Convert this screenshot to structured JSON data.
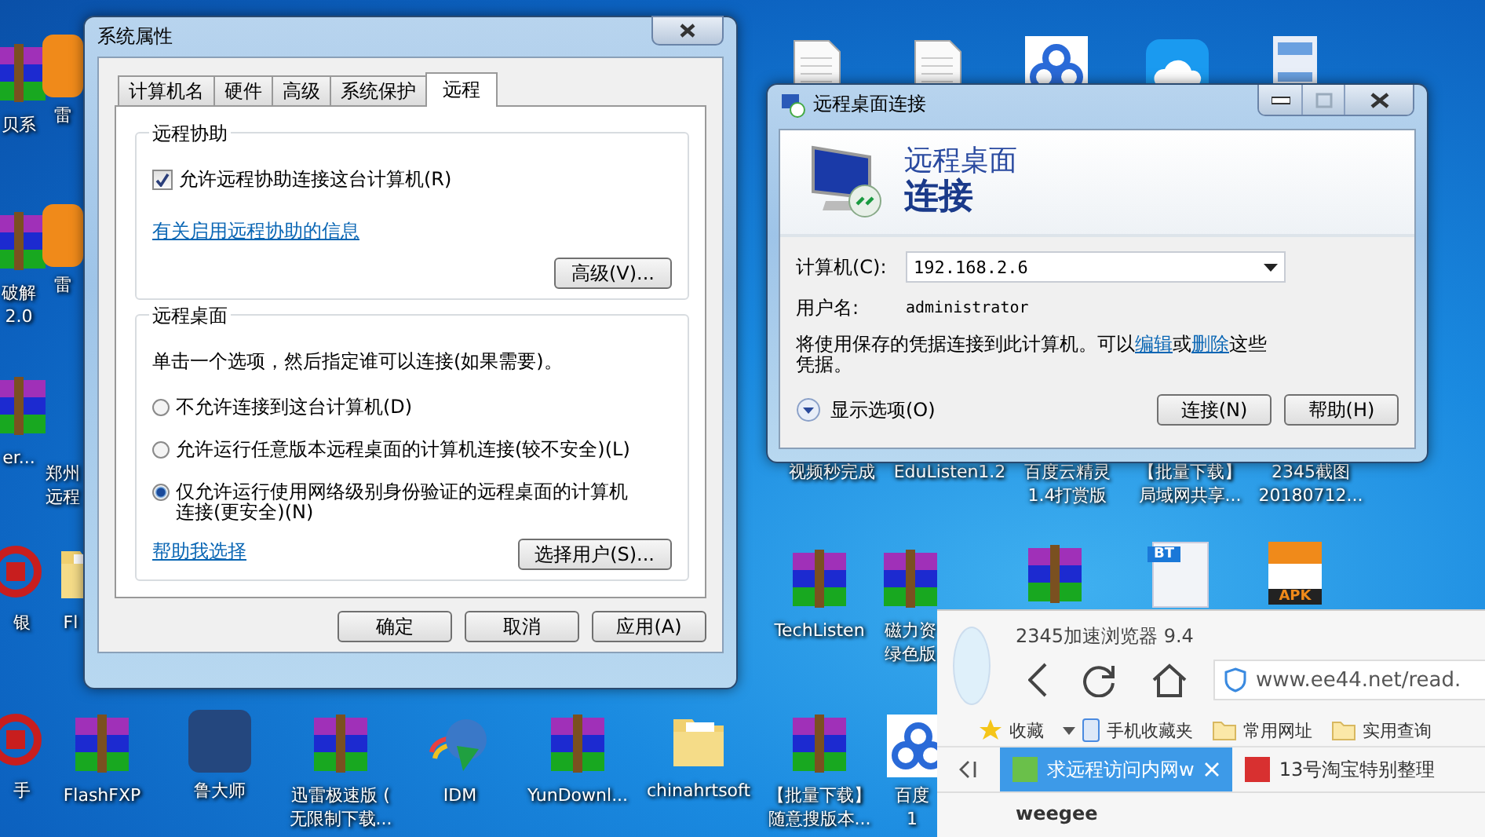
{
  "desktop_icons": [
    {
      "kind": "archive",
      "lines": [
        "贝系"
      ]
    },
    {
      "kind": "orange",
      "lines": [
        "雷"
      ]
    },
    {
      "kind": "archive",
      "lines": [
        "破解",
        "2.0"
      ]
    },
    {
      "kind": "orange",
      "lines": [
        "雷"
      ]
    },
    {
      "kind": "archive",
      "lines": [
        "er..."
      ]
    },
    {
      "kind": "hidden",
      "lines": [
        "郑州",
        "远程"
      ]
    },
    {
      "kind": "redring",
      "lines": [
        "银"
      ]
    },
    {
      "kind": "folder",
      "lines": [
        "Fl"
      ]
    },
    {
      "kind": "redring",
      "lines": [
        "手"
      ]
    },
    {
      "kind": "archive",
      "lines": [
        "FlashFXP"
      ]
    },
    {
      "kind": "app",
      "lines": [
        "鲁大师"
      ]
    },
    {
      "kind": "archive",
      "lines": [
        "迅雷极速版 (",
        "无限制下载..."
      ]
    },
    {
      "kind": "globe",
      "lines": [
        "IDM"
      ]
    },
    {
      "kind": "archive",
      "lines": [
        "YunDownl..."
      ]
    },
    {
      "kind": "folder",
      "lines": [
        "chinahrtsoft"
      ]
    },
    {
      "kind": "archive",
      "lines": [
        "【批量下载】",
        "随意搜版本..."
      ]
    },
    {
      "kind": "baidu",
      "lines": [
        "百度",
        "1"
      ]
    },
    {
      "kind": "document"
    },
    {
      "kind": "document"
    },
    {
      "kind": "baidu"
    },
    {
      "kind": "cloud"
    },
    {
      "kind": "screenshot"
    },
    {
      "kind": "hidden",
      "lines": [
        "视频秒完成"
      ]
    },
    {
      "kind": "hidden",
      "lines": [
        "EduListen1.2"
      ]
    },
    {
      "kind": "hidden",
      "lines": [
        "百度云精灵",
        "1.4打赏版"
      ]
    },
    {
      "kind": "hidden",
      "lines": [
        "【批量下载】",
        "局域网共享..."
      ]
    },
    {
      "kind": "hidden",
      "lines": [
        "2345截图",
        "20180712..."
      ]
    },
    {
      "kind": "archive",
      "lines": [
        "TechListen"
      ]
    },
    {
      "kind": "archive",
      "lines": [
        "磁力资",
        "绿色版"
      ]
    },
    {
      "kind": "archive"
    },
    {
      "kind": "badgedoc",
      "badge": "BT"
    },
    {
      "kind": "apk",
      "badge": "APK"
    }
  ],
  "system_properties": {
    "title": "系统属性",
    "tabs": [
      {
        "label": "计算机名",
        "selected": false
      },
      {
        "label": "硬件",
        "selected": false
      },
      {
        "label": "高级",
        "selected": false
      },
      {
        "label": "系统保护",
        "selected": false
      },
      {
        "label": "远程",
        "selected": true
      }
    ],
    "assistance": {
      "title": "远程协助",
      "checkbox": {
        "label": "允许远程协助连接这台计算机(R)",
        "checked": true
      },
      "link": "有关启用远程协助的信息",
      "button": "高级(V)..."
    },
    "remote_desktop": {
      "title": "远程桌面",
      "instruction": "单击一个选项，然后指定谁可以连接(如果需要)。",
      "options": [
        {
          "label": "不允许连接到这台计算机(D)",
          "selected": false
        },
        {
          "label": "允许运行任意版本远程桌面的计算机连接(较不安全)(L)",
          "selected": false
        },
        {
          "label": "仅允许运行使用网络级别身份验证的远程桌面的计算机连接(更安全)(N)",
          "selected": true
        }
      ],
      "link": "帮助我选择",
      "button": "选择用户(S)..."
    },
    "buttons": [
      "确定",
      "取消",
      "应用(A)"
    ]
  },
  "remote_connection": {
    "title": "远程桌面连接",
    "heading_line1": "远程桌面",
    "heading_line2": "连接",
    "computer_label": "计算机(C):",
    "computer_value": "192.168.2.6",
    "user_label": "用户名:",
    "user_value": "administrator",
    "note_start": "将使用保存的凭据连接到此计算机。可以",
    "edit_link": "编辑",
    "note_middle": "或",
    "delete_link": "删除",
    "note_end": "这些凭据。",
    "options_toggle": "显示选项(O)",
    "buttons": [
      "连接(N)",
      "帮助(H)"
    ]
  },
  "browser": {
    "title": "2345加速浏览器 9.4",
    "address": "www.ee44.net/read.",
    "bookmarks": [
      "收藏",
      "手机收藏夹",
      "常用网址",
      "实用查询"
    ],
    "tabs": [
      {
        "label": "求远程访问内网w",
        "selected": true
      },
      {
        "label": "13号淘宝特别整理",
        "selected": false
      }
    ],
    "content": [
      "weegee"
    ]
  }
}
